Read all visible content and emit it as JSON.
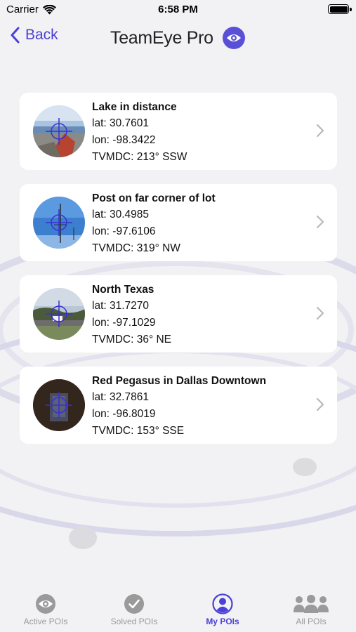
{
  "status_bar": {
    "carrier": "Carrier",
    "time": "6:58 PM"
  },
  "nav": {
    "back_label": "Back",
    "title": "TeamEye Pro",
    "eye_icon": "eye-icon",
    "accent_color": "#4a3fd6"
  },
  "pois": [
    {
      "name": "Lake in distance",
      "lat": "lat: 30.7601",
      "lon": "lon: -98.3422",
      "tvmdc": "TVMDC: 213° SSW"
    },
    {
      "name": "Post on far corner of lot",
      "lat": "lat: 30.4985",
      "lon": "lon: -97.6106",
      "tvmdc": "TVMDC: 319° NW"
    },
    {
      "name": "North Texas",
      "lat": "lat: 31.7270",
      "lon": "lon: -97.1029",
      "tvmdc": "TVMDC: 36° NE"
    },
    {
      "name": "Red Pegasus in Dallas Downtown",
      "lat": "lat: 32.7861",
      "lon": "lon: -96.8019",
      "tvmdc": "TVMDC: 153° SSE"
    }
  ],
  "tabs": [
    {
      "label": "Active POIs",
      "icon": "eye-icon",
      "active": false
    },
    {
      "label": "Solved POIs",
      "icon": "checkmark-icon",
      "active": false
    },
    {
      "label": "My POIs",
      "icon": "person-icon",
      "active": true
    },
    {
      "label": "All POIs",
      "icon": "group-icon",
      "active": false
    }
  ]
}
